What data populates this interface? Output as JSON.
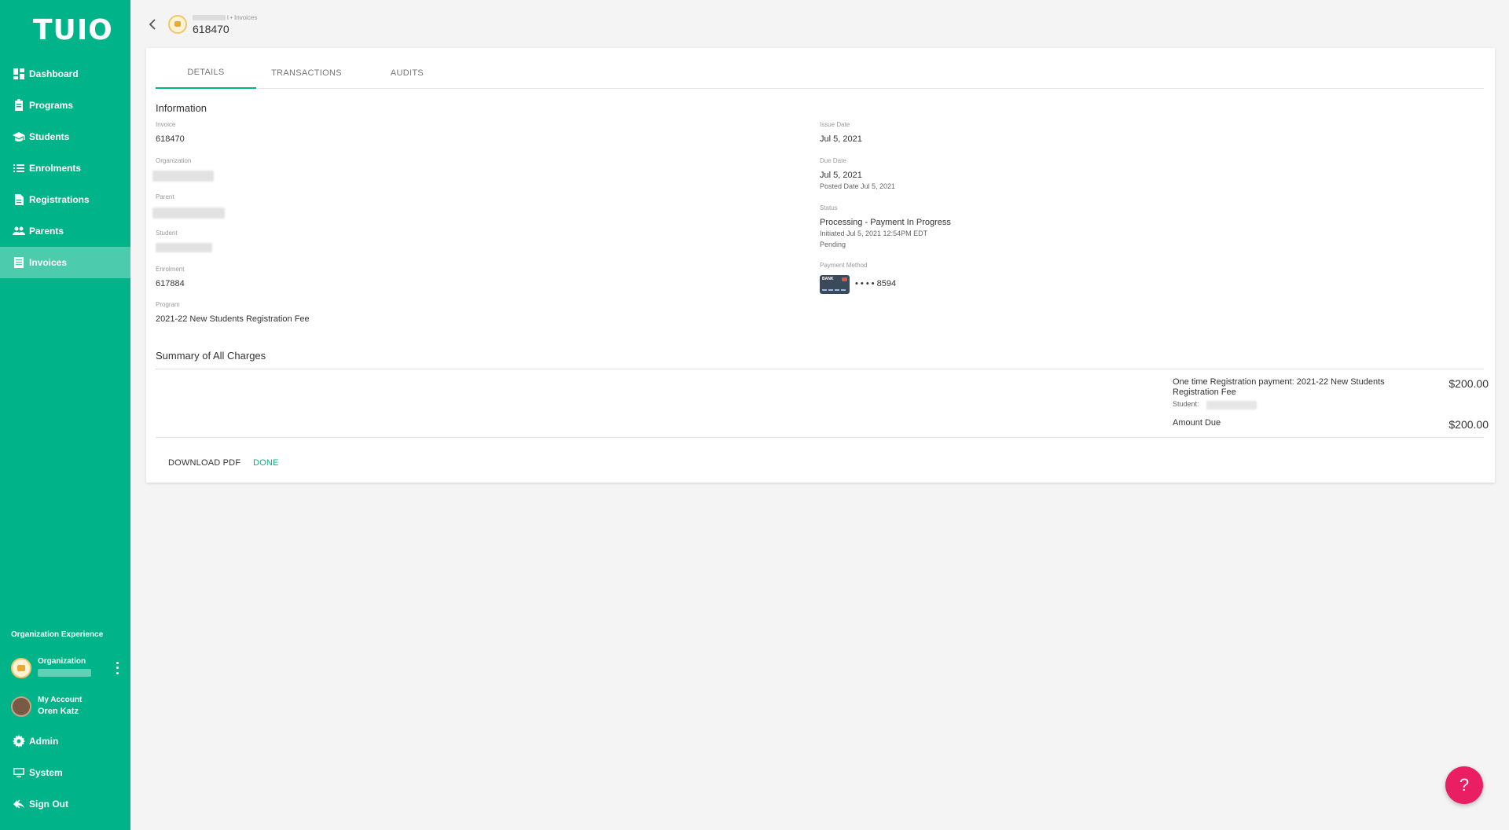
{
  "app": {
    "logo_text": "TUIO",
    "brand_color": "#00b388",
    "accent_color": "#e91e63"
  },
  "sidebar": {
    "items": [
      {
        "label": "Dashboard",
        "icon": "dashboard-icon"
      },
      {
        "label": "Programs",
        "icon": "clipboard-icon"
      },
      {
        "label": "Students",
        "icon": "graduation-cap-icon"
      },
      {
        "label": "Enrolments",
        "icon": "list-icon"
      },
      {
        "label": "Registrations",
        "icon": "document-icon"
      },
      {
        "label": "Parents",
        "icon": "people-icon"
      },
      {
        "label": "Invoices",
        "icon": "invoice-icon",
        "active": true
      }
    ],
    "org_experience_label": "Organization Experience",
    "organization_label": "Organization",
    "my_account_label": "My Account",
    "account_name": "Oren Katz",
    "bottom_items": [
      {
        "label": "Admin",
        "icon": "gear-icon"
      },
      {
        "label": "System",
        "icon": "monitor-icon"
      },
      {
        "label": "Sign Out",
        "icon": "sign-out-icon"
      }
    ]
  },
  "header": {
    "breadcrumb_suffix": "l • Invoices",
    "title": "618470"
  },
  "tabs": [
    {
      "label": "DETAILS",
      "active": true
    },
    {
      "label": "TRANSACTIONS",
      "active": false
    },
    {
      "label": "AUDITS",
      "active": false
    }
  ],
  "information": {
    "section_title": "Information",
    "invoice_label": "Invoice",
    "invoice_value": "618470",
    "organization_label": "Organization",
    "parent_label": "Parent",
    "student_label": "Student",
    "enrolment_label": "Enrolment",
    "enrolment_value": "617884",
    "program_label": "Program",
    "program_value": "2021-22 New Students Registration Fee",
    "issue_date_label": "Issue Date",
    "issue_date_value": "Jul 5, 2021",
    "due_date_label": "Due Date",
    "due_date_value": "Jul 5, 2021",
    "posted_date_text": "Posted Date Jul 5, 2021",
    "status_label": "Status",
    "status_value": "Processing - Payment In Progress",
    "status_initiated": "Initiated Jul 5, 2021 12:54PM EDT",
    "status_pending": "Pending",
    "payment_method_label": "Payment Method",
    "payment_card_text": "BANK",
    "payment_last4": "• • • • 8594"
  },
  "charges": {
    "section_title": "Summary of All Charges",
    "line_description": "One time Registration payment: 2021-22 New Students Registration Fee",
    "line_student_label": "Student:",
    "line_amount": "$200.00",
    "amount_due_label": "Amount Due",
    "amount_due_value": "$200.00"
  },
  "actions": {
    "download_label": "DOWNLOAD PDF",
    "done_label": "DONE"
  },
  "help": {
    "label": "?"
  }
}
